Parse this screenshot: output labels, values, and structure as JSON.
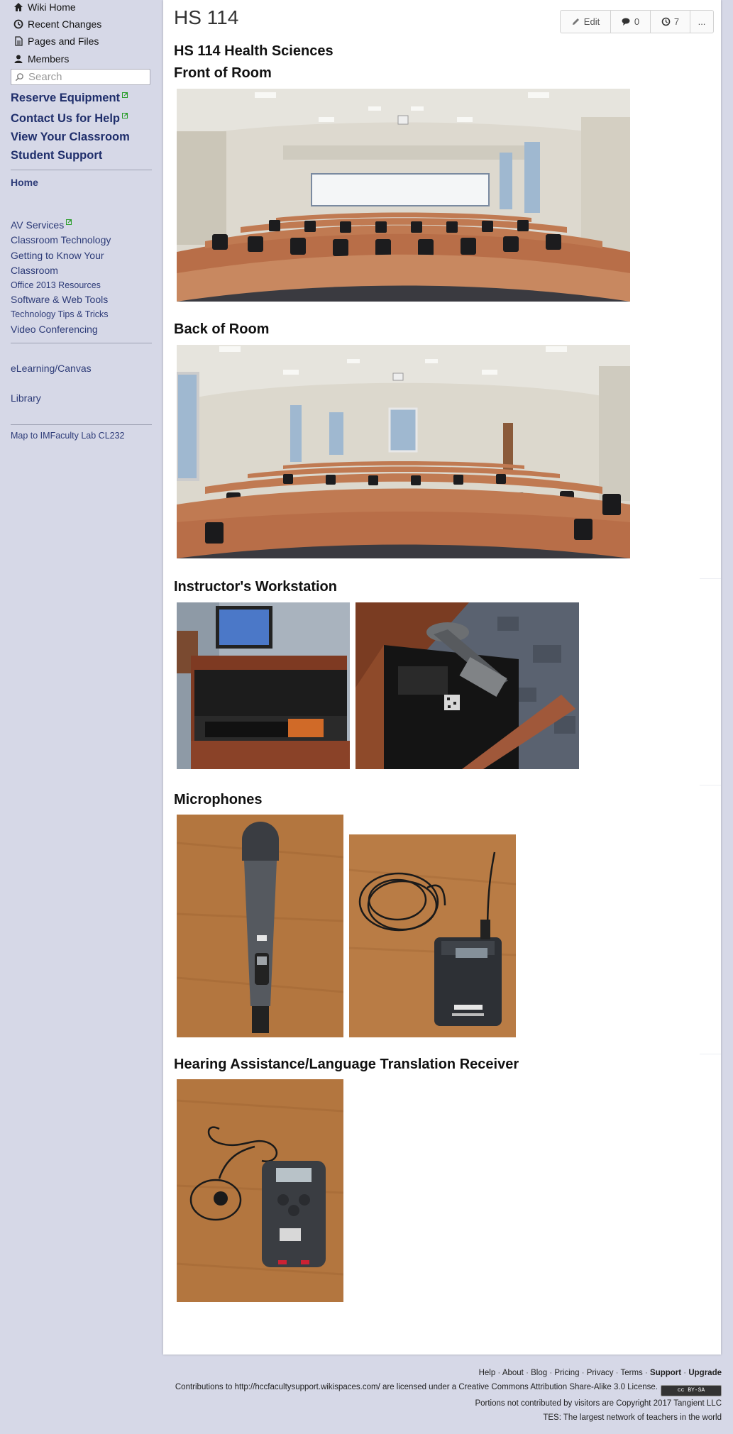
{
  "sidebar": {
    "nav": [
      {
        "label": "Wiki Home",
        "icon": "home-icon"
      },
      {
        "label": "Recent Changes",
        "icon": "clock-icon"
      },
      {
        "label": "Pages and Files",
        "icon": "file-icon"
      },
      {
        "label": "Members",
        "icon": "user-icon"
      }
    ],
    "search_placeholder": "Search",
    "primary_links": [
      "Reserve Equipment",
      "Contact Us for Help",
      "View Your Classroom",
      "Student Support"
    ],
    "home": "Home",
    "links_group1": [
      "AV Services",
      "Classroom Technology",
      "Getting to Know Your",
      "Classroom",
      "Office 2013 Resources",
      "Software & Web Tools",
      "Technology Tips & Tricks",
      "Video Conferencing"
    ],
    "links_group2": [
      "eLearning/Canvas",
      "Library"
    ],
    "links_group3": [
      "Map to IMFaculty Lab CL232"
    ]
  },
  "page": {
    "title": "HS 114",
    "toolbar": {
      "edit": "Edit",
      "comments": "0",
      "revisions": "7",
      "more": "..."
    },
    "headings": {
      "building": "HS 114 Health Sciences",
      "front": "Front of Room",
      "back": "Back of Room",
      "workstation": "Instructor's Workstation",
      "microphones": "Microphones",
      "hearing": "Hearing Assistance/Language Translation Receiver"
    }
  },
  "footer": {
    "links": [
      "Help",
      "About",
      "Blog",
      "Pricing",
      "Privacy",
      "Terms",
      "Support",
      "Upgrade"
    ],
    "license_text": "Contributions to http://hccfacultysupport.wikispaces.com/ are licensed under a Creative Commons Attribution Share-Alike 3.0 License.",
    "badge": "cc BY-SA",
    "copyright": "Portions not contributed by visitors are Copyright 2017 Tangient LLC",
    "tes": "TES: The largest network of teachers in the world"
  },
  "colors": {
    "sidebar_bg": "#d6d8e7",
    "link": "#2d3b78",
    "primary_link": "#1f2e6b",
    "external_mark": "#2a9d2a"
  }
}
